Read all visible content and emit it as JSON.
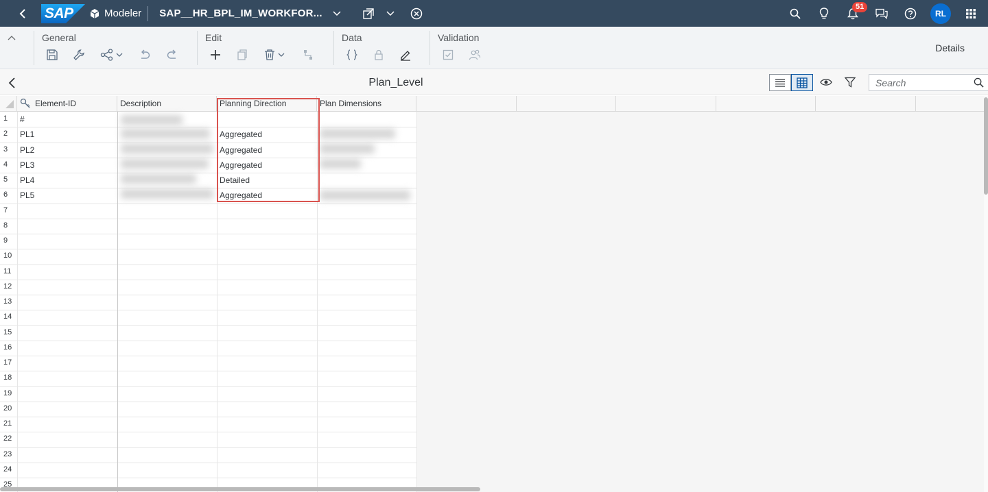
{
  "shell": {
    "logo_text": "SAP",
    "app_name": "Modeler",
    "model_title": "SAP__HR_BPL_IM_WORKFOR...",
    "notification_count": "51",
    "user_initials": "RL"
  },
  "toolbar": {
    "groups": [
      {
        "label": "General"
      },
      {
        "label": "Edit"
      },
      {
        "label": "Data"
      },
      {
        "label": "Validation"
      }
    ],
    "details_label": "Details"
  },
  "subheader": {
    "title": "Plan_Level",
    "search_placeholder": "Search"
  },
  "grid": {
    "columns": [
      "Element-ID",
      "Description",
      "Planning Direction",
      "Plan Dimensions"
    ],
    "row_numbers": [
      "1",
      "2",
      "3",
      "4",
      "5",
      "6",
      "7",
      "8",
      "9",
      "10",
      "11",
      "12",
      "13",
      "14",
      "15",
      "16",
      "17",
      "18",
      "19",
      "20",
      "21",
      "22",
      "23",
      "24",
      "25"
    ],
    "rows": [
      {
        "id": "#",
        "planning_direction": ""
      },
      {
        "id": "PL1",
        "planning_direction": "Aggregated"
      },
      {
        "id": "PL2",
        "planning_direction": "Aggregated"
      },
      {
        "id": "PL3",
        "planning_direction": "Aggregated"
      },
      {
        "id": "PL4",
        "planning_direction": "Detailed"
      },
      {
        "id": "PL5",
        "planning_direction": "Aggregated"
      }
    ]
  },
  "colors": {
    "shell_bg": "#354a5f",
    "accent": "#0a6ed1",
    "badge": "#e9443a",
    "highlight": "#d9534f"
  }
}
